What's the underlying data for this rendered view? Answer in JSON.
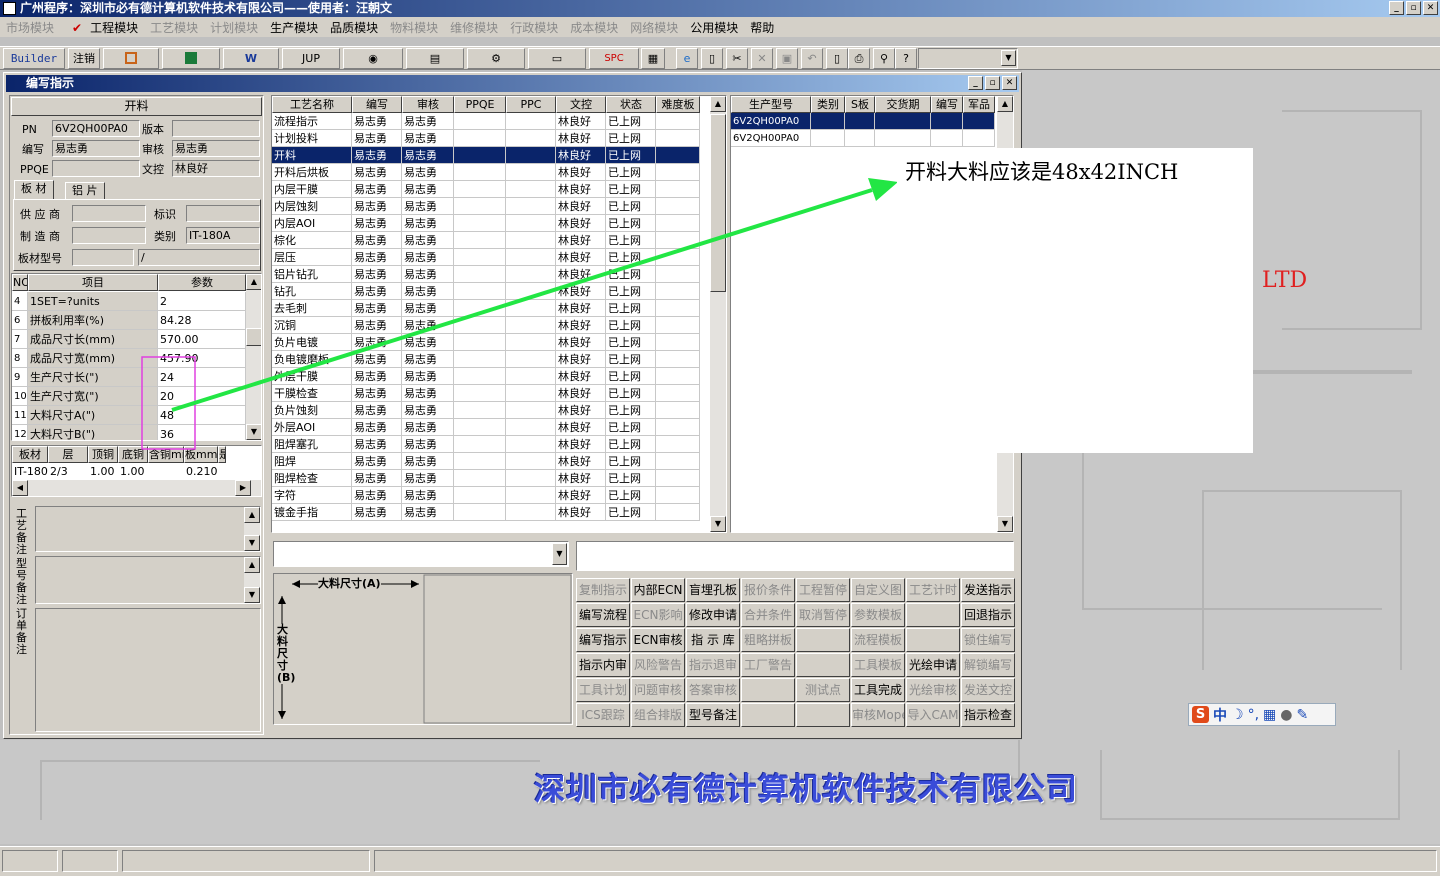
{
  "app_title": "广州程序：深圳市必有德计算机软件技术有限公司——使用者：汪朝文",
  "menu": [
    {
      "label": "市场模块",
      "disabled": true
    },
    {
      "label": "工程模块",
      "disabled": false,
      "checked": true
    },
    {
      "label": "工艺模块",
      "disabled": true
    },
    {
      "label": "计划模块",
      "disabled": true
    },
    {
      "label": "生产模块",
      "disabled": false
    },
    {
      "label": "品质模块",
      "disabled": false
    },
    {
      "label": "物料模块",
      "disabled": true
    },
    {
      "label": "维修模块",
      "disabled": true
    },
    {
      "label": "行政模块",
      "disabled": true
    },
    {
      "label": "成本模块",
      "disabled": true
    },
    {
      "label": "网络模块",
      "disabled": true
    },
    {
      "label": "公用模块",
      "disabled": false
    },
    {
      "label": "帮助",
      "disabled": false
    }
  ],
  "toolbar": {
    "builder": "Builder",
    "logout": "注销",
    "jup": "JUP",
    "spc": "SPC",
    "w": "W"
  },
  "window_title": "编写指示",
  "left": {
    "header": "开料",
    "pn_label": "PN",
    "pn_value": "6V2QH00PA0",
    "version_label": "版本",
    "version_value": "",
    "writer_label": "编写",
    "writer_value": "易志勇",
    "review_label": "审核",
    "review_value": "易志勇",
    "ppqe_label": "PPQE",
    "ppqe_value": "",
    "doc_label": "文控",
    "doc_value": "林良好",
    "tab_board": "板 材",
    "tab_copper": "铝 片",
    "supplier_label": "供 应 商",
    "supplier_value": "",
    "mark_label": "标识",
    "mark_value": "",
    "maker_label": "制 造 商",
    "maker_value": "",
    "type_label": "类别",
    "type_value": "IT-180A",
    "model_label": "板材型号",
    "model_value": "",
    "model_value2": "/",
    "param_headers": {
      "no": "NO",
      "item": "项目",
      "param": "参数"
    },
    "params": [
      {
        "no": "4",
        "item": "1SET=?units",
        "value": "2"
      },
      {
        "no": "6",
        "item": "拼板利用率(%)",
        "value": "84.28"
      },
      {
        "no": "7",
        "item": "成品尺寸长(mm)",
        "value": "570.00"
      },
      {
        "no": "8",
        "item": "成品尺寸宽(mm)",
        "value": "457.90"
      },
      {
        "no": "9",
        "item": "生产尺寸长(\")",
        "value": "24"
      },
      {
        "no": "10",
        "item": "生产尺寸宽(\")",
        "value": "20"
      },
      {
        "no": "11",
        "item": "大料尺寸A(\")",
        "value": "48"
      },
      {
        "no": "12",
        "item": "大料尺寸B(\")",
        "value": "36"
      }
    ],
    "mat_headers": [
      "板材",
      "层",
      "顶铜",
      "底铜",
      "含铜mm",
      "板mm",
      "是"
    ],
    "mat_row": [
      "IT-180A",
      "2/3",
      "1.00",
      "1.00",
      "",
      "0.210",
      ""
    ],
    "note1_label": "工艺备注",
    "note2_label": "型号备注",
    "note3_label": "订单备注"
  },
  "process": {
    "headers": [
      "工艺名称",
      "编写",
      "审核",
      "PPQE",
      "PPC",
      "文控",
      "状态",
      "难度板"
    ],
    "rows": [
      [
        "流程指示",
        "易志勇",
        "易志勇",
        "",
        "",
        "林良好",
        "已上网",
        ""
      ],
      [
        "计划投料",
        "易志勇",
        "易志勇",
        "",
        "",
        "林良好",
        "已上网",
        ""
      ],
      [
        "开料",
        "易志勇",
        "易志勇",
        "",
        "",
        "林良好",
        "已上网",
        ""
      ],
      [
        "开料后烘板",
        "易志勇",
        "易志勇",
        "",
        "",
        "林良好",
        "已上网",
        ""
      ],
      [
        "内层干膜",
        "易志勇",
        "易志勇",
        "",
        "",
        "林良好",
        "已上网",
        ""
      ],
      [
        "内层蚀刻",
        "易志勇",
        "易志勇",
        "",
        "",
        "林良好",
        "已上网",
        ""
      ],
      [
        "内层AOI",
        "易志勇",
        "易志勇",
        "",
        "",
        "林良好",
        "已上网",
        ""
      ],
      [
        "棕化",
        "易志勇",
        "易志勇",
        "",
        "",
        "林良好",
        "已上网",
        ""
      ],
      [
        "层压",
        "易志勇",
        "易志勇",
        "",
        "",
        "林良好",
        "已上网",
        ""
      ],
      [
        "铝片钻孔",
        "易志勇",
        "易志勇",
        "",
        "",
        "林良好",
        "已上网",
        ""
      ],
      [
        "钻孔",
        "易志勇",
        "易志勇",
        "",
        "",
        "林良好",
        "已上网",
        ""
      ],
      [
        "去毛刺",
        "易志勇",
        "易志勇",
        "",
        "",
        "林良好",
        "已上网",
        ""
      ],
      [
        "沉铜",
        "易志勇",
        "易志勇",
        "",
        "",
        "林良好",
        "已上网",
        ""
      ],
      [
        "负片电镀",
        "易志勇",
        "易志勇",
        "",
        "",
        "林良好",
        "已上网",
        ""
      ],
      [
        "负电镀磨板",
        "易志勇",
        "易志勇",
        "",
        "",
        "林良好",
        "已上网",
        ""
      ],
      [
        "外层干膜",
        "易志勇",
        "易志勇",
        "",
        "",
        "林良好",
        "已上网",
        ""
      ],
      [
        "干膜检查",
        "易志勇",
        "易志勇",
        "",
        "",
        "林良好",
        "已上网",
        ""
      ],
      [
        "负片蚀刻",
        "易志勇",
        "易志勇",
        "",
        "",
        "林良好",
        "已上网",
        ""
      ],
      [
        "外层AOI",
        "易志勇",
        "易志勇",
        "",
        "",
        "林良好",
        "已上网",
        ""
      ],
      [
        "阻焊塞孔",
        "易志勇",
        "易志勇",
        "",
        "",
        "林良好",
        "已上网",
        ""
      ],
      [
        "阻焊",
        "易志勇",
        "易志勇",
        "",
        "",
        "林良好",
        "已上网",
        ""
      ],
      [
        "阻焊检查",
        "易志勇",
        "易志勇",
        "",
        "",
        "林良好",
        "已上网",
        ""
      ],
      [
        "字符",
        "易志勇",
        "易志勇",
        "",
        "",
        "林良好",
        "已上网",
        ""
      ],
      [
        "镀金手指",
        "易志勇",
        "易志勇",
        "",
        "",
        "林良好",
        "已上网",
        ""
      ]
    ],
    "selected_index": 2
  },
  "models": {
    "headers": [
      "生产型号",
      "类别",
      "S板",
      "交货期",
      "编写",
      "军品"
    ],
    "rows": [
      [
        "6V2QH00PA0",
        "",
        "",
        "",
        "",
        ""
      ],
      [
        "6V2QH00PA0",
        "",
        "",
        "",
        "",
        ""
      ]
    ],
    "selected_index": 0
  },
  "diagram": {
    "a_label": "大料尺寸(A)",
    "b_label": "大料尺寸(B)"
  },
  "actions": [
    [
      {
        "l": "复制指示",
        "d": true
      },
      {
        "l": "内部ECN",
        "d": false
      },
      {
        "l": "盲埋孔板",
        "d": false
      },
      {
        "l": "报价条件",
        "d": true
      },
      {
        "l": "工程暂停",
        "d": true
      },
      {
        "l": "自定义图",
        "d": true
      },
      {
        "l": "工艺计时",
        "d": true
      },
      {
        "l": "发送指示",
        "d": false
      }
    ],
    [
      {
        "l": "编写流程",
        "d": false
      },
      {
        "l": "ECN影响",
        "d": true
      },
      {
        "l": "修改申请",
        "d": false
      },
      {
        "l": "合并条件",
        "d": true
      },
      {
        "l": "取消暂停",
        "d": true
      },
      {
        "l": "参数模板",
        "d": true
      },
      {
        "l": "",
        "d": true
      },
      {
        "l": "回退指示",
        "d": false
      }
    ],
    [
      {
        "l": "编写指示",
        "d": false
      },
      {
        "l": "ECN审核",
        "d": false
      },
      {
        "l": "指 示 库",
        "d": false
      },
      {
        "l": "粗略拼板",
        "d": true
      },
      {
        "l": "",
        "d": true
      },
      {
        "l": "流程模板",
        "d": true
      },
      {
        "l": "",
        "d": true
      },
      {
        "l": "锁住编写",
        "d": true
      }
    ],
    [
      {
        "l": "指示内审",
        "d": false
      },
      {
        "l": "风险警告",
        "d": true
      },
      {
        "l": "指示退审",
        "d": true
      },
      {
        "l": "工厂警告",
        "d": true
      },
      {
        "l": "",
        "d": true
      },
      {
        "l": "工具模板",
        "d": true
      },
      {
        "l": "光绘申请",
        "d": false
      },
      {
        "l": "解锁编写",
        "d": true
      }
    ],
    [
      {
        "l": "工具计划",
        "d": true
      },
      {
        "l": "问题审核",
        "d": true
      },
      {
        "l": "答案审核",
        "d": true
      },
      {
        "l": "",
        "d": true
      },
      {
        "l": "测试点",
        "d": true
      },
      {
        "l": "工具完成",
        "d": false
      },
      {
        "l": "光绘审核",
        "d": true
      },
      {
        "l": "发送文控",
        "d": true
      }
    ],
    [
      {
        "l": "ICS跟踪",
        "d": true
      },
      {
        "l": "组合排版",
        "d": true
      },
      {
        "l": "型号备注",
        "d": false
      },
      {
        "l": "",
        "d": true
      },
      {
        "l": "",
        "d": true
      },
      {
        "l": "审核Mope",
        "d": true
      },
      {
        "l": "导入CAM",
        "d": true
      },
      {
        "l": "指示检查",
        "d": false
      }
    ]
  ],
  "annotation": "开料大料应该是48x42INCH",
  "ltd_text": "，LTD",
  "company_watermark": "深圳市必有德计算机软件技术有限公司",
  "ime": {
    "zh": "中"
  },
  "colors": {
    "title_start": "#0a246a",
    "selection": "#0a246a",
    "arrow": "#22e644",
    "highlight_box": "#e040e0",
    "watermark": "#3a4cd8",
    "ltd": "#e02020"
  }
}
